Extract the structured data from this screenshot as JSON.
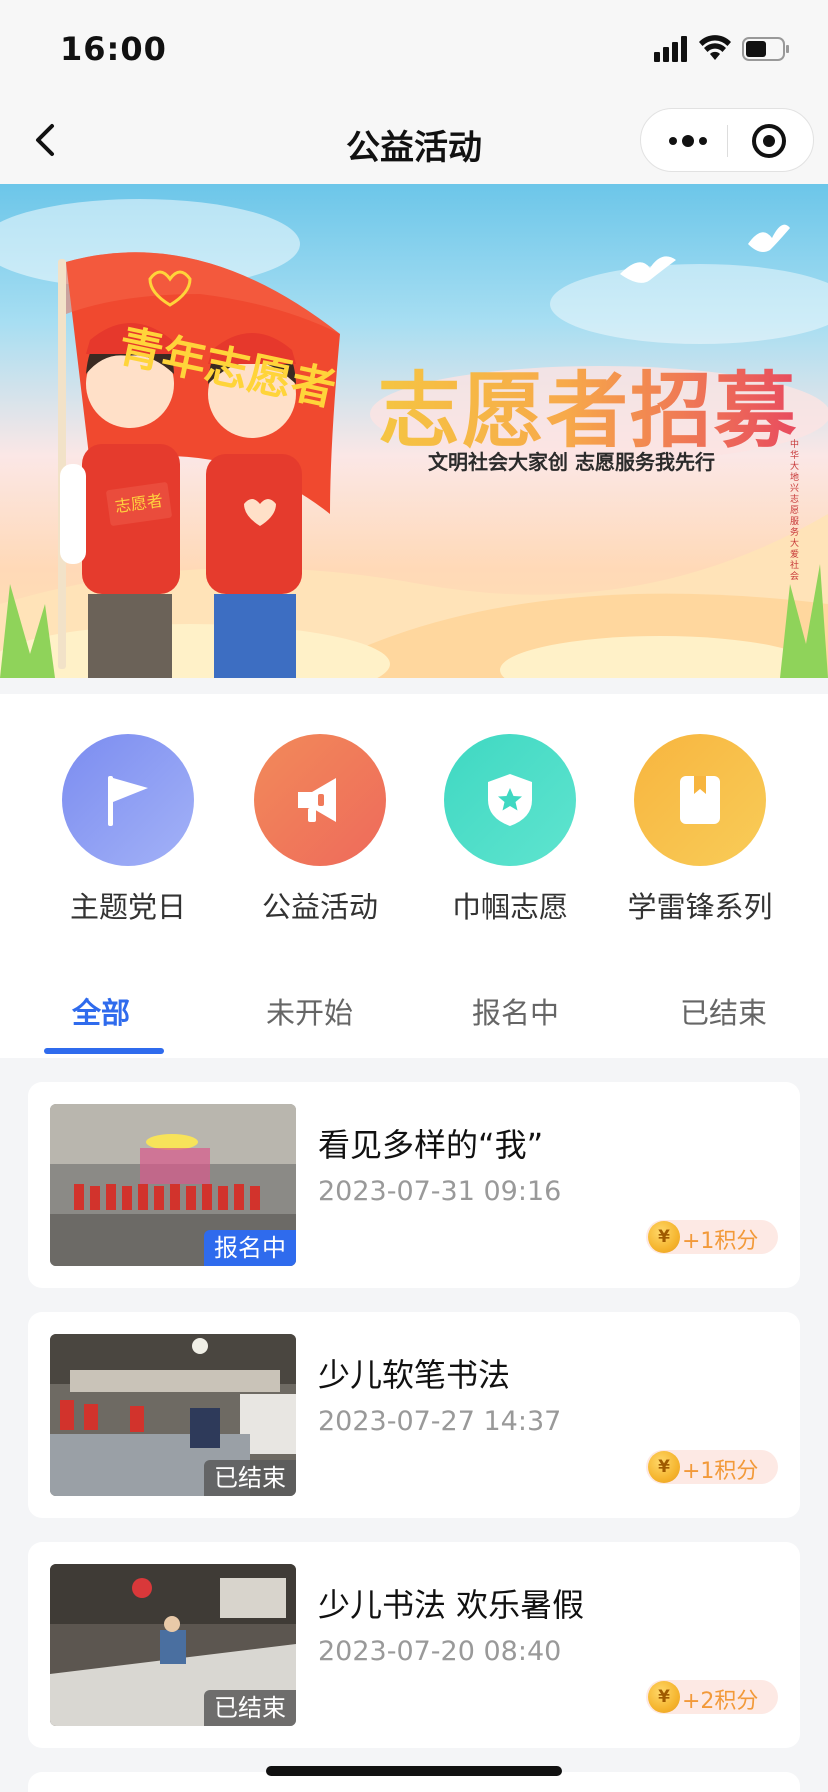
{
  "status_bar": {
    "time": "16:00",
    "icons": [
      "signal-icon",
      "wifi-icon",
      "battery-icon"
    ]
  },
  "nav": {
    "title": "公益活动",
    "back_icon": "chevron-left-icon",
    "more_icon": "more-dots-icon",
    "close_icon": "target-icon"
  },
  "banner": {
    "title": "志愿者招募",
    "subtitle": "文明社会大家创 志愿服务我先行",
    "flag_text": "青年志愿者",
    "badge_text": "志愿者",
    "vertical_text": "中华大地兴志愿服务大爱社会"
  },
  "categories": [
    {
      "label": "主题党日",
      "icon": "flag-icon",
      "color_from": "#7b8cf0",
      "color_to": "#a3b2f7"
    },
    {
      "label": "公益活动",
      "icon": "megaphone-icon",
      "color_from": "#f28a5a",
      "color_to": "#ee6a5b"
    },
    {
      "label": "巾帼志愿",
      "icon": "shield-star-icon",
      "color_from": "#3fd8c2",
      "color_to": "#5fe4cf"
    },
    {
      "label": "学雷锋系列",
      "icon": "bookmark-icon",
      "color_from": "#f7b53f",
      "color_to": "#f9cc58"
    }
  ],
  "tabs": [
    {
      "label": "全部",
      "active": true
    },
    {
      "label": "未开始",
      "active": false
    },
    {
      "label": "报名中",
      "active": false
    },
    {
      "label": "已结束",
      "active": false
    }
  ],
  "activities": [
    {
      "title": "看见多样的“我”",
      "date": "2023-07-31 09:16",
      "status": "报名中",
      "points": "+1积分",
      "coin": "¥"
    },
    {
      "title": "少儿软笔书法",
      "date": "2023-07-27 14:37",
      "status": "已结束",
      "points": "+1积分",
      "coin": "¥"
    },
    {
      "title": "少儿书法 欢乐暑假",
      "date": "2023-07-20 08:40",
      "status": "已结束",
      "points": "+2积分",
      "coin": "¥"
    }
  ],
  "colors": {
    "accent": "#2f6bed",
    "points_text": "#f29a3a",
    "points_bg": "#fde9e4"
  }
}
